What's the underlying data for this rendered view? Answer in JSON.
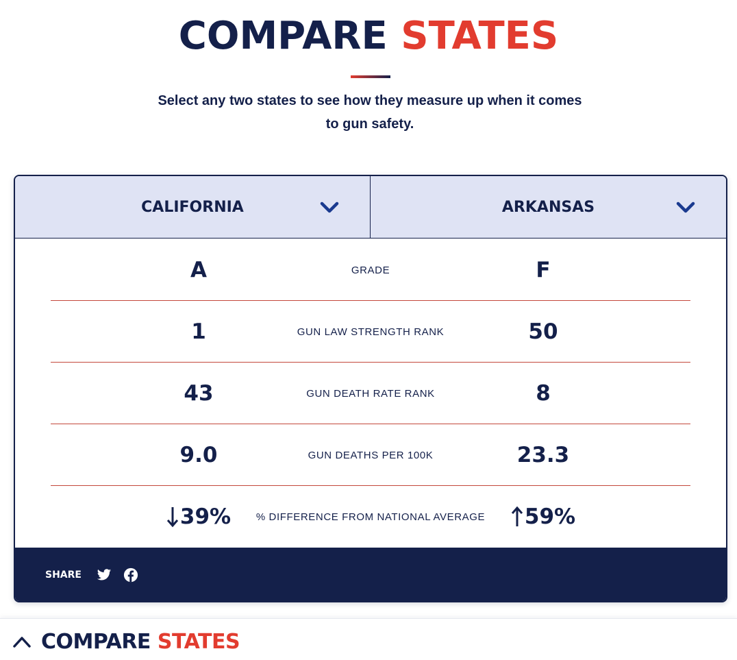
{
  "header": {
    "title_part1": "COMPARE",
    "title_part2": "STATES",
    "subtitle": "Select any two states to see how they measure up when it comes to gun safety."
  },
  "colors": {
    "navy": "#14204a",
    "red": "#e23c2f",
    "selector_bg": "#dfe3f4"
  },
  "selectors": {
    "left": {
      "label": "CALIFORNIA",
      "icon": "chevron-down-icon"
    },
    "right": {
      "label": "ARKANSAS",
      "icon": "chevron-down-icon"
    }
  },
  "rows": [
    {
      "metric": "GRADE",
      "a": "A",
      "b": "F"
    },
    {
      "metric": "GUN LAW STRENGTH RANK",
      "a": "1",
      "b": "50"
    },
    {
      "metric": "GUN DEATH RATE RANK",
      "a": "43",
      "b": "8"
    },
    {
      "metric": "GUN DEATHS PER 100K",
      "a": "9.0",
      "b": "23.3"
    },
    {
      "metric": "% DIFFERENCE FROM NATIONAL AVERAGE",
      "a": "39%",
      "a_icon": "arrow-down-icon",
      "b": "59%",
      "b_icon": "arrow-up-icon"
    }
  ],
  "share": {
    "label": "SHARE",
    "icons": [
      "twitter-icon",
      "facebook-icon"
    ]
  },
  "sticky": {
    "title_part1": "COMPARE",
    "title_part2": "STATES",
    "icon": "chevron-up-icon"
  }
}
